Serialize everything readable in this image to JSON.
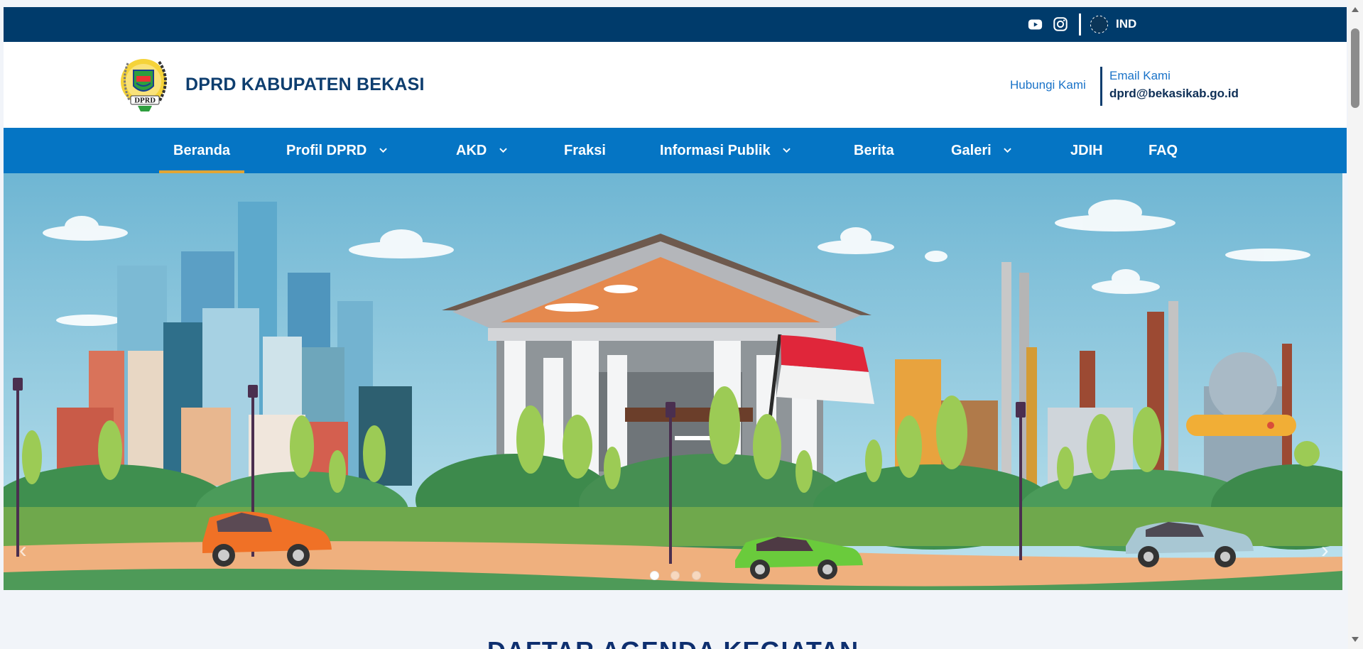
{
  "topbar": {
    "social": [
      "youtube-icon",
      "instagram-icon"
    ],
    "language": "IND"
  },
  "header": {
    "brand": "DPRD KABUPATEN BEKASI",
    "contact_link": "Hubungi Kami",
    "email_label": "Email Kami",
    "email_value": "dprd@bekasikab.go.id"
  },
  "nav": {
    "items": [
      {
        "label": "Beranda",
        "dropdown": false,
        "active": true
      },
      {
        "label": "Profil DPRD",
        "dropdown": true
      },
      {
        "label": "AKD",
        "dropdown": true
      },
      {
        "label": "Fraksi",
        "dropdown": false
      },
      {
        "label": "Informasi Publik",
        "dropdown": true
      },
      {
        "label": "Berita",
        "dropdown": false
      },
      {
        "label": "Galeri",
        "dropdown": true
      },
      {
        "label": "JDIH",
        "dropdown": false
      },
      {
        "label": "FAQ",
        "dropdown": false
      }
    ]
  },
  "carousel": {
    "slide_count": 3,
    "active_slide": 1
  },
  "main": {
    "section_title": "DAFTAR AGENDA KEGIATAN"
  },
  "colors": {
    "topbar": "#003b6b",
    "nav": "#0575c4",
    "active_underline": "#e1a534",
    "brand_text": "#0e3e6f"
  }
}
